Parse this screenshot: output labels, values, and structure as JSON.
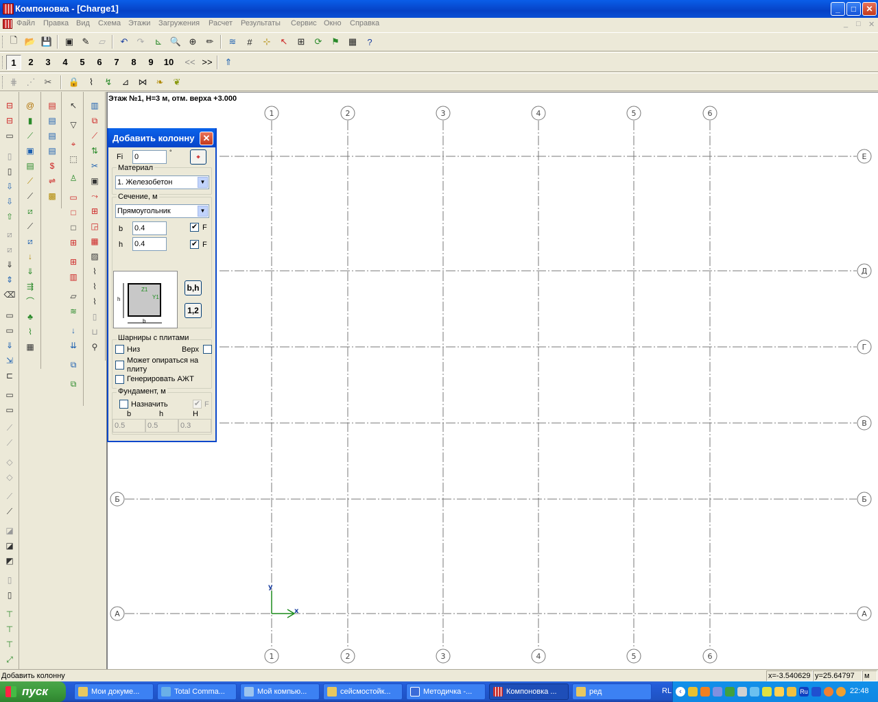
{
  "window": {
    "title": "Компоновка - [Charge1]",
    "controls": {
      "minimize": "_",
      "maximize": "□",
      "close": "✕"
    }
  },
  "menu": {
    "items": [
      "Файл",
      "Правка",
      "Вид",
      "Схема",
      "Этажи",
      "Загружения",
      "Расчет",
      "Результаты",
      "Сервис",
      "Окно",
      "Справка"
    ],
    "mdi_controls": [
      "_",
      "□",
      "✕"
    ]
  },
  "floor_toolbar": {
    "floors": [
      "1",
      "2",
      "3",
      "4",
      "5",
      "6",
      "7",
      "8",
      "9",
      "10"
    ],
    "active_floor": "1",
    "prev_label": "<<",
    "next_label": ">>"
  },
  "canvas": {
    "floor_info": "Этаж №1, H=3 м, отм. верха +3.000",
    "axes_numeric": [
      "1",
      "2",
      "3",
      "4",
      "5",
      "6"
    ],
    "axes_letter": [
      "Е",
      "Д",
      "Г",
      "В",
      "Б",
      "А"
    ],
    "origin_x_label": "x",
    "origin_y_label": "y"
  },
  "dialog": {
    "title": "Добавить колонну",
    "fi_label": "Fi",
    "fi_value": "0",
    "fi_unit": "°",
    "material_label": "Материал",
    "material_value": "1. Железобетон",
    "section_label": "Сечение, м",
    "section_value": "Прямоугольник",
    "b_label": "b",
    "b_value": "0.4",
    "b_f_label": "F",
    "h_label": "h",
    "h_value": "0.4",
    "h_f_label": "F",
    "preview_labels": {
      "z": "Z1",
      "y": "Y1",
      "b": "b",
      "h": "h"
    },
    "bh_button": "b,h",
    "swap_button": "1,2",
    "hinges_label": "Шарниры с плитами",
    "hinge_bottom": "Низ",
    "hinge_top": "Верх",
    "can_rest_on_slab": "Может опираться на плиту",
    "generate_azht": "Генерировать АЖТ",
    "foundation_label": "Фундамент, м",
    "assign_label": "Назначить",
    "assign_f": "F",
    "foundation_cols": [
      "b",
      "h",
      "H"
    ],
    "foundation_values": [
      "0.5",
      "0.5",
      "0.3"
    ]
  },
  "status": {
    "text": "Добавить колонну",
    "x_coord": "x=-3.540629",
    "y_coord": "y=25.64797",
    "unit": "м"
  },
  "taskbar": {
    "start_label": "пуск",
    "tasks": [
      "Мои докуме...",
      "Total Comma...",
      "Мой компью...",
      "сейсмостойк...",
      "Методичка -...",
      "Компоновка ...",
      "ред"
    ],
    "active_task": "Компоновка ...",
    "language": "RL",
    "clock": "22:48"
  }
}
